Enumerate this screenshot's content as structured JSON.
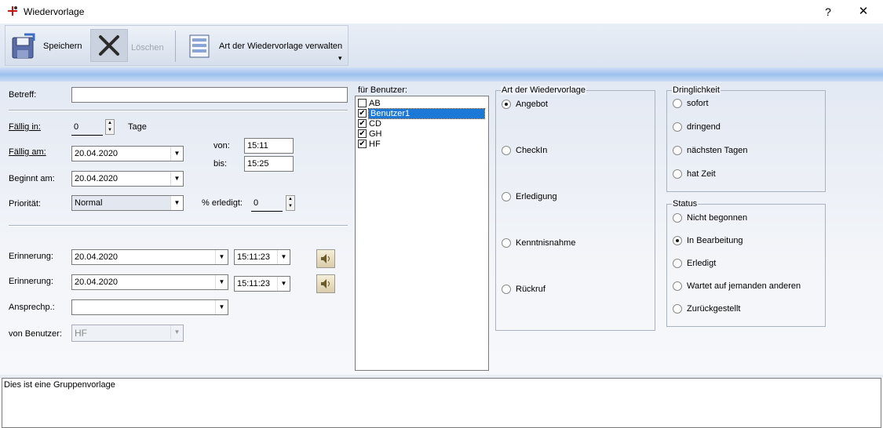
{
  "window": {
    "title": "Wiedervorlage",
    "help": "?",
    "close": "✕"
  },
  "toolbar": {
    "save_label": "Speichern",
    "delete_label": "Löschen",
    "art_label": "Art der Wiedervorlage verwalten",
    "overflow": "▾"
  },
  "form": {
    "betreff_label": "Betreff:",
    "betreff_value": "",
    "faellig_in_label": "Fällig in:",
    "faellig_in_value": "0",
    "tage_label": "Tage",
    "faellig_am_label": "Fällig am:",
    "faellig_am_value": "20.04.2020",
    "von_label": "von:",
    "von_value": "15:11",
    "bis_label": "bis:",
    "bis_value": "15:25",
    "beginnt_am_label": "Beginnt am:",
    "beginnt_am_value": "20.04.2020",
    "prioritaet_label": "Priorität:",
    "prioritaet_value": "Normal",
    "erledigt_label": "% erledigt:",
    "erledigt_value": "0",
    "erinnerung1_label": "Erinnerung:",
    "erinnerung1_date": "20.04.2020",
    "erinnerung1_time": "15:11:23",
    "erinnerung2_label": "Erinnerung:",
    "erinnerung2_date": "20.04.2020",
    "erinnerung2_time": "15:11:23",
    "ansprechp_label": "Ansprechp.:",
    "ansprechp_value": "",
    "von_benutzer_label": "von Benutzer:",
    "von_benutzer_value": "HF"
  },
  "users": {
    "title": "für Benutzer:",
    "items": [
      {
        "label": "AB",
        "checked": false,
        "selected": false
      },
      {
        "label": "Benutzer1",
        "checked": true,
        "selected": true
      },
      {
        "label": "CD",
        "checked": true,
        "selected": false
      },
      {
        "label": "GH",
        "checked": true,
        "selected": false
      },
      {
        "label": "HF",
        "checked": true,
        "selected": false
      }
    ]
  },
  "art": {
    "title": "Art der Wiedervorlage",
    "options": [
      "Angebot",
      "CheckIn",
      "Erledigung",
      "Kenntnisnahme",
      "Rückruf"
    ],
    "selected": "Angebot"
  },
  "dringlichkeit": {
    "title": "Dringlichkeit",
    "options": [
      "sofort",
      "dringend",
      "nächsten Tagen",
      "hat Zeit"
    ],
    "selected": ""
  },
  "status": {
    "title": "Status",
    "options": [
      "Nicht begonnen",
      "In Bearbeitung",
      "Erledigt",
      "Wartet auf jemanden anderen",
      "Zurückgestellt"
    ],
    "selected": "In Bearbeitung"
  },
  "note": {
    "text": "Dies ist eine Gruppenvorlage"
  },
  "icons": {
    "app": "app-pin-icon",
    "save": "floppy-disk-icon",
    "delete": "x-delete-icon",
    "art": "list-manage-icon",
    "speaker": "speaker-icon"
  }
}
